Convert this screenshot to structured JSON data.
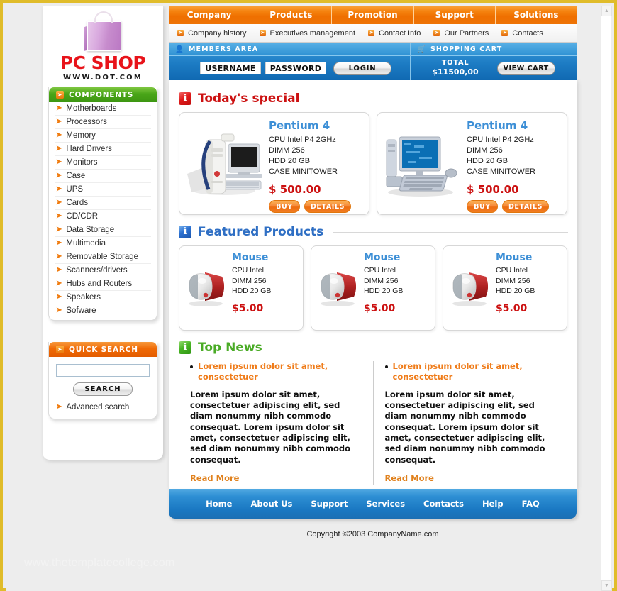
{
  "logo": {
    "title": "PC SHOP",
    "url": "WWW.DOT.COM",
    "icon": "shopping-bag-icon"
  },
  "topnav": {
    "items": [
      {
        "label": "Company"
      },
      {
        "label": "Products"
      },
      {
        "label": "Promotion"
      },
      {
        "label": "Support"
      },
      {
        "label": "Solutions"
      }
    ]
  },
  "subnav": {
    "items": [
      {
        "label": "Company history"
      },
      {
        "label": "Executives management"
      },
      {
        "label": "Contact Info"
      },
      {
        "label": "Our Partners"
      },
      {
        "label": "Contacts"
      }
    ]
  },
  "members": {
    "title": "MEMBERS AREA",
    "icon": "user-icon",
    "username_value": "USERNAME",
    "password_value": "PASSWORD",
    "login_label": "LOGIN"
  },
  "cart": {
    "title": "SHOPPING CART",
    "icon": "cart-icon",
    "total_label": "TOTAL",
    "total_value": "$11500,00",
    "view_cart_label": "VIEW CART"
  },
  "sidebar": {
    "components": {
      "title": "COMPONENTS",
      "items": [
        {
          "label": "Motherboards"
        },
        {
          "label": "Processors"
        },
        {
          "label": "Memory"
        },
        {
          "label": "Hard Drivers"
        },
        {
          "label": "Monitors"
        },
        {
          "label": "Case"
        },
        {
          "label": "UPS"
        },
        {
          "label": "Cards"
        },
        {
          "label": "CD/CDR"
        },
        {
          "label": "Data Storage"
        },
        {
          "label": "Multimedia"
        },
        {
          "label": "Removable Storage"
        },
        {
          "label": "Scanners/drivers"
        },
        {
          "label": "Hubs and Routers"
        },
        {
          "label": "Speakers"
        },
        {
          "label": "Sofware"
        }
      ]
    },
    "quick_search": {
      "title": "QUICK SEARCH",
      "input_value": "",
      "input_placeholder": "",
      "button_label": "SEARCH",
      "advanced_label": "Advanced search"
    }
  },
  "sections": {
    "special": {
      "title": "Today's special",
      "icon": "info-icon"
    },
    "featured": {
      "title": "Featured Products",
      "icon": "info-icon"
    },
    "news": {
      "title": "Top News",
      "icon": "info-icon"
    }
  },
  "special_products": [
    {
      "name": "Pentium 4",
      "specs": [
        "CPU Intel P4 2GHz",
        "DIMM 256",
        "HDD 20 GB",
        "CASE MINITOWER"
      ],
      "price": "$ 500.00",
      "buy_label": "BUY",
      "details_label": "DETAILS",
      "image": "desktop-tower-computer-image"
    },
    {
      "name": "Pentium 4",
      "specs": [
        "CPU Intel P4 2GHz",
        "DIMM 256",
        "HDD 20 GB",
        "CASE MINITOWER"
      ],
      "price": "$ 500.00",
      "buy_label": "BUY",
      "details_label": "DETAILS",
      "image": "flat-panel-computer-image"
    }
  ],
  "featured_products": [
    {
      "name": "Mouse",
      "specs": [
        "CPU Intel",
        "DIMM 256",
        "HDD 20 GB"
      ],
      "price": "$5.00",
      "image": "computer-mouse-image"
    },
    {
      "name": "Mouse",
      "specs": [
        "CPU Intel",
        "DIMM 256",
        "HDD 20 GB"
      ],
      "price": "$5.00",
      "image": "computer-mouse-image"
    },
    {
      "name": "Mouse",
      "specs": [
        "CPU Intel",
        "DIMM 256",
        "HDD 20 GB"
      ],
      "price": "$5.00",
      "image": "computer-mouse-image"
    }
  ],
  "news_items": [
    {
      "title": "Lorem ipsum dolor sit amet, consectetuer",
      "body": "Lorem ipsum dolor sit amet, consectetuer adipiscing elit, sed diam nonummy nibh commodo consequat. Lorem ipsum dolor sit amet, consectetuer adipiscing elit, sed diam nonummy nibh commodo consequat.",
      "read_more_label": "Read More"
    },
    {
      "title": "Lorem ipsum dolor sit amet, consectetuer",
      "body": "Lorem ipsum dolor sit amet, consectetuer adipiscing elit, sed diam nonummy nibh commodo consequat. Lorem ipsum dolor sit amet, consectetuer adipiscing elit, sed diam nonummy nibh commodo consequat.",
      "read_more_label": "Read More"
    }
  ],
  "footer": {
    "links": [
      {
        "label": "Home"
      },
      {
        "label": "About Us"
      },
      {
        "label": "Support"
      },
      {
        "label": "Services"
      },
      {
        "label": "Contacts"
      },
      {
        "label": "Help"
      },
      {
        "label": "FAQ"
      }
    ],
    "copyright": "Copyright ©2003 CompanyName.com"
  },
  "watermark": "www.thetemplatecollege.com",
  "colors": {
    "page_border": "#e0bc2a",
    "page_bg": "#ededed",
    "orange": "#ef6f00",
    "blue": "#1d7cc4",
    "green": "#49a518",
    "red": "#cc1111",
    "link_blue": "#3d8fd6",
    "news_orange": "#ef7c1a"
  }
}
